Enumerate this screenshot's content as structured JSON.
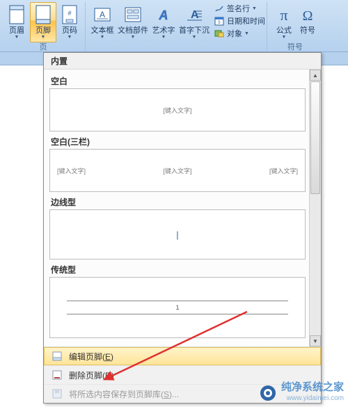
{
  "ribbon": {
    "groups": {
      "hf": {
        "label": "页",
        "header_btn": "页眉",
        "footer_btn": "页脚",
        "pagenum_btn": "页码"
      },
      "text_items": {
        "textbox": "文本框",
        "parts": "文档部件",
        "wordart": "艺术字",
        "dropcap": "首字下沉"
      },
      "text_small": {
        "sign": "签名行",
        "datetime": "日期和时间",
        "object": "对象"
      },
      "symbols": {
        "label": "符号",
        "equation": "公式",
        "symbol": "符号"
      }
    }
  },
  "gallery": {
    "title": "内置",
    "sections": {
      "blank": "空白",
      "blank3": "空白(三栏)",
      "border": "边线型",
      "traditional": "传统型"
    },
    "placeholder": "[键入文字]",
    "cursor": "|",
    "page_number": "1",
    "actions": {
      "edit": {
        "text": "编辑页脚",
        "hotkey": "E"
      },
      "remove": {
        "text": "删除页脚",
        "hotkey": "R"
      },
      "save": {
        "text": "将所选内容保存到页脚库",
        "hotkey": "S"
      }
    }
  },
  "watermark": {
    "line1": "纯净系统之家",
    "line2": "www.yidaimei.com"
  }
}
